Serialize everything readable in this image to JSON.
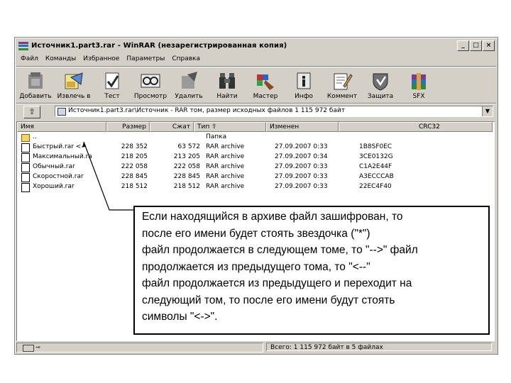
{
  "window": {
    "title": "Источник1.part3.rar - WinRAR (незарегистрированная копия)",
    "buttons": {
      "minimize": "_",
      "maximize": "□",
      "close": "×"
    }
  },
  "menu": [
    "Файл",
    "Команды",
    "Избранное",
    "Параметры",
    "Справка"
  ],
  "toolbar": [
    {
      "label": "Добавить",
      "icon": "add-icon"
    },
    {
      "label": "Извлечь в",
      "icon": "extract-icon"
    },
    {
      "label": "Тест",
      "icon": "test-icon"
    },
    {
      "label": "Просмотр",
      "icon": "view-icon"
    },
    {
      "label": "Удалить",
      "icon": "delete-icon"
    },
    {
      "label": "Найти",
      "icon": "find-icon"
    },
    {
      "label": "Мастер",
      "icon": "wizard-icon"
    },
    {
      "label": "Инфо",
      "icon": "info-icon"
    },
    {
      "label": "Коммент",
      "icon": "comment-icon"
    },
    {
      "label": "Защита",
      "icon": "protect-icon"
    },
    {
      "label": "SFX",
      "icon": "sfx-icon"
    }
  ],
  "address": {
    "up_label": "⇧",
    "text": "Источник1.part3.rar\\Источник - RAR том, размер исходных файлов 1 115 972 байт"
  },
  "columns": [
    "Имя",
    "Размер",
    "Сжат",
    "Тип",
    "Изменен",
    "CRC32"
  ],
  "files": [
    {
      "name": "..",
      "size": "",
      "packed": "",
      "type": "Папка",
      "modified": "",
      "crc": "",
      "folder": true
    },
    {
      "name": "Быстрый.rar <--",
      "size": "228 352",
      "packed": "63 572",
      "type": "RAR archive",
      "modified": "27.09.2007 0:33",
      "crc": "1B8SF0EC",
      "folder": false
    },
    {
      "name": "Максимальный.ra",
      "size": "218 205",
      "packed": "213 205",
      "type": "RAR archive",
      "modified": "27.09.2007 0:34",
      "crc": "3CE0132G",
      "folder": false
    },
    {
      "name": "Обычный.rar",
      "size": "222 058",
      "packed": "222 058",
      "type": "RAR archive",
      "modified": "27.09.2007 0:33",
      "crc": "C1A2E44F",
      "folder": false
    },
    {
      "name": "Скоростной.rar",
      "size": "228 845",
      "packed": "228 845",
      "type": "RAR archive",
      "modified": "27.09.2007 0:33",
      "crc": "A3ECCCAB",
      "folder": false
    },
    {
      "name": "Хороший.rar",
      "size": "218 512",
      "packed": "218 512",
      "type": "RAR archive",
      "modified": "27.09.2007 0:33",
      "crc": "22EC4F40",
      "folder": false
    }
  ],
  "callout": {
    "text": "Если находящийся в архиве файл зашифрован, то\nпосле его имени будет стоять звездочка (\"*\")\nфайл продолжается в следующем томе, то \"-->\" файл\nпродолжается из предыдущего тома, то \"<--\"\nфайл продолжается из предыдущего и переходит на\nследующий том, то после его имени будут стоять\nсимволы \"<->\"."
  },
  "status": {
    "right": "Всего: 1 115 972 байт в 5 файлах"
  },
  "colors": {
    "window_bg": "#d4d0c8",
    "title_text": "#000000"
  }
}
